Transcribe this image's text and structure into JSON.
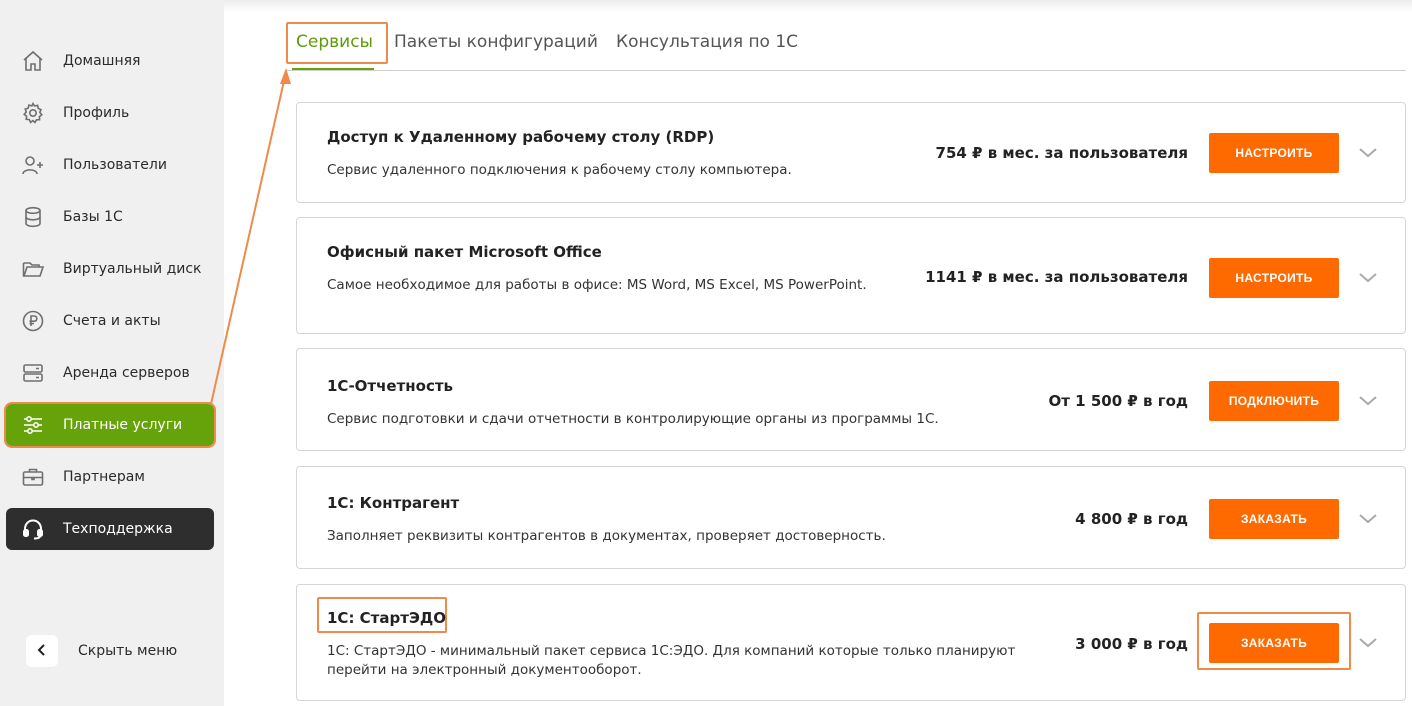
{
  "sidebar": {
    "items": [
      {
        "label": "Домашняя",
        "icon": "home-icon"
      },
      {
        "label": "Профиль",
        "icon": "gear-icon"
      },
      {
        "label": "Пользователи",
        "icon": "user-add-icon"
      },
      {
        "label": "Базы 1С",
        "icon": "database-icon"
      },
      {
        "label": "Виртуальный диск",
        "icon": "folder-icon"
      },
      {
        "label": "Счета и акты",
        "icon": "ruble-icon"
      },
      {
        "label": "Аренда серверов",
        "icon": "server-icon"
      },
      {
        "label": "Платные услуги",
        "icon": "sliders-icon",
        "active": true
      },
      {
        "label": "Партнерам",
        "icon": "briefcase-icon"
      },
      {
        "label": "Техподдержка",
        "icon": "headset-icon"
      }
    ],
    "hide_menu_label": "Скрыть меню"
  },
  "tabs": [
    {
      "label": "Сервисы",
      "active": true
    },
    {
      "label": "Пакеты конфигураций"
    },
    {
      "label": "Консультация по 1С"
    }
  ],
  "services": [
    {
      "title": "Доступ к Удаленному рабочему столу (RDP)",
      "description": "Сервис удаленного подключения к рабочему столу компьютера.",
      "price": "754 ₽ в мес. за пользователя",
      "button": "НАСТРОИТЬ"
    },
    {
      "title": "Офисный пакет Microsoft Office",
      "description": "Самое необходимое для работы в офисе: MS Word, MS Excel, MS PowerPoint.",
      "price": "1141 ₽ в мес. за пользователя",
      "button": "НАСТРОИТЬ"
    },
    {
      "title": "1С-Отчетность",
      "description": "Сервис подготовки и сдачи отчетности в контролирующие органы из программы 1С.",
      "price": "От 1 500 ₽ в год",
      "button": "ПОДКЛЮЧИТЬ"
    },
    {
      "title": "1С: Контрагент",
      "description": "Заполняет реквизиты контрагентов в документах, проверяет достоверность.",
      "price": "4 800 ₽ в год",
      "button": "ЗАКАЗАТЬ"
    },
    {
      "title": "1С: СтартЭДО",
      "description": "1С: СтартЭДО - минимальный пакет сервиса 1С:ЭДО. Для компаний которые только планируют перейти на электронный документооборот.",
      "price": "3 000 ₽ в год",
      "button": "ЗАКАЗАТЬ"
    }
  ],
  "colors": {
    "accent_orange": "#ff6a00",
    "active_green": "#66a30a",
    "highlight_outline": "#f08a4b",
    "support_dark": "#2e2e2e"
  }
}
